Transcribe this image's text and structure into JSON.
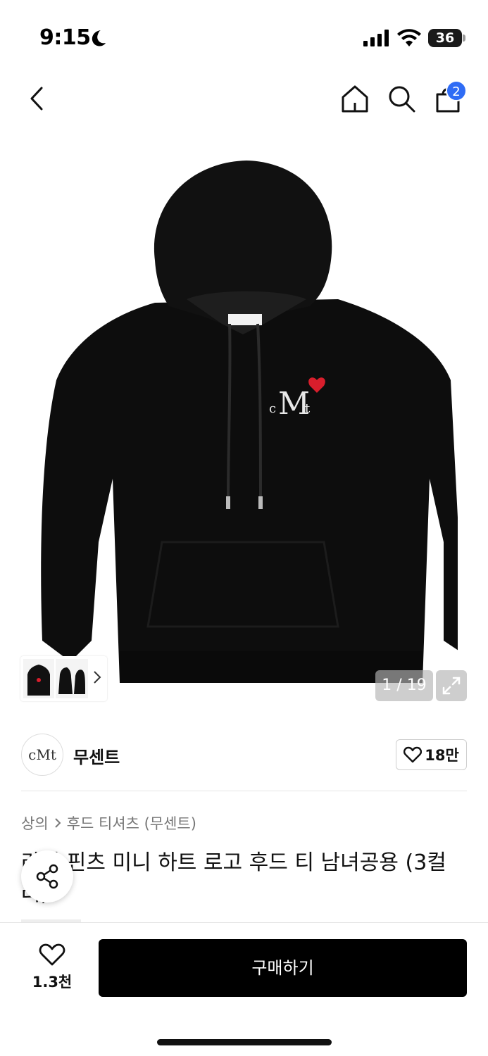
{
  "status_bar": {
    "time": "9:15",
    "battery": "36"
  },
  "nav": {
    "cart_count": "2"
  },
  "gallery": {
    "page_indicator": "1 / 19"
  },
  "brand": {
    "logo_text": "cMt",
    "name": "무센트",
    "like_count": "18만"
  },
  "breadcrumb": {
    "category": "상의",
    "subcategory": "후드 티셔츠 (무센트)"
  },
  "product": {
    "title": "라이 핀츠 미니 하트 로고 후드 티 남녀공용 (3컬러)"
  },
  "bottom": {
    "wish_count": "1.3천",
    "buy_label": "구매하기"
  },
  "colors": {
    "accent": "#2f6cf5",
    "buy_bg": "#000000",
    "heart": "#d81e2c"
  }
}
